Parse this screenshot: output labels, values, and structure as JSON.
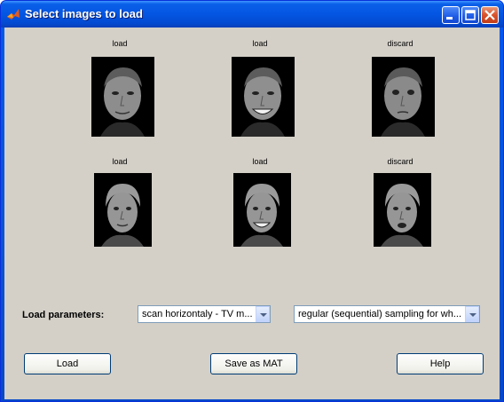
{
  "window": {
    "title": "Select images to load",
    "icon": "matlab-icon",
    "controls": [
      "minimize-icon",
      "maximize-icon",
      "close-icon"
    ]
  },
  "images": [
    {
      "status": "load"
    },
    {
      "status": "load"
    },
    {
      "status": "discard"
    },
    {
      "status": "load"
    },
    {
      "status": "load"
    },
    {
      "status": "discard"
    }
  ],
  "params": {
    "label": "Load parameters:",
    "scan_mode": "scan horizontaly - TV m...",
    "sampling": "regular (sequential) sampling for wh..."
  },
  "buttons": {
    "load": "Load",
    "save_mat": "Save as MAT",
    "help": "Help"
  },
  "colors": {
    "titlebar": "#0a5fe8",
    "panel": "#d4d0c8",
    "close_button": "#d8532c"
  }
}
